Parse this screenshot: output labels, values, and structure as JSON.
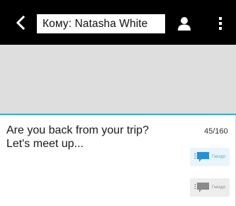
{
  "header": {
    "back_icon": "back-arrow-icon",
    "recipient_field": "Кому: Natasha White",
    "contact_icon": "person-icon",
    "menu_icon": "overflow-menu-icon"
  },
  "compose": {
    "message": "Are you back from your trip?\nLet's meet up...",
    "char_count": "45/160",
    "send_button_1_label": "Гнездо",
    "send_button_2_label": "Гнездо"
  },
  "colors": {
    "topbar": "#000000",
    "thread_background": "#dedede",
    "accent": "#3aa7e4"
  }
}
